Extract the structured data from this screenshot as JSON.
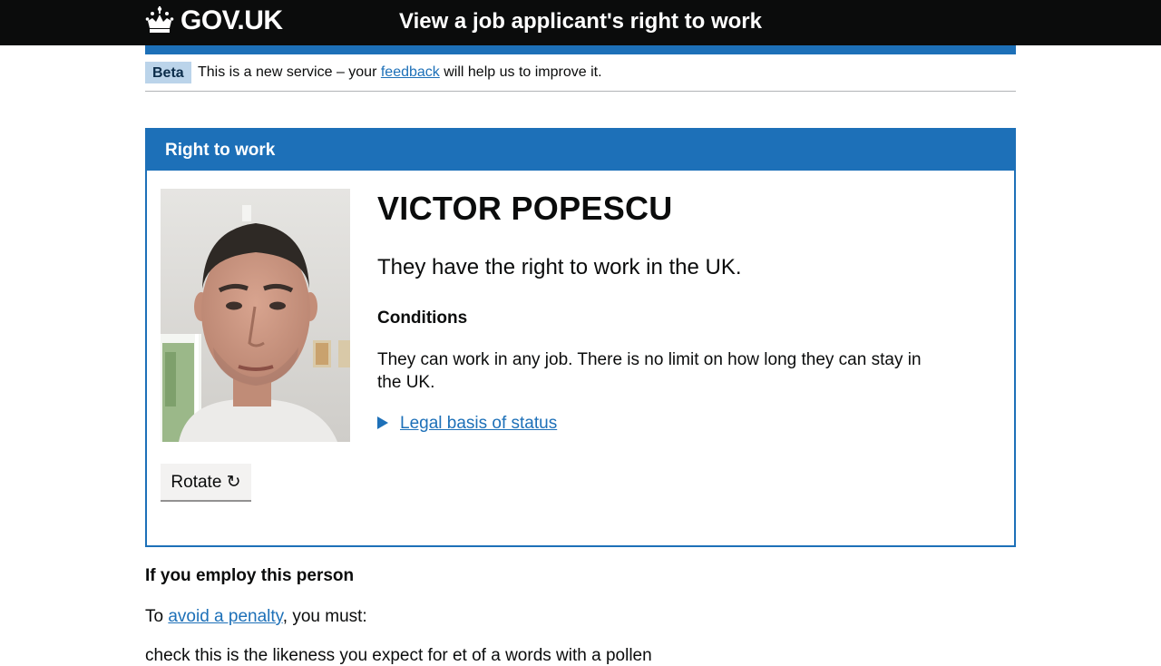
{
  "header": {
    "logo_text": "GOV.UK",
    "service_name": "View a job applicant's right to work"
  },
  "phase_banner": {
    "tag": "Beta",
    "text_before": "This is a new service – your ",
    "link_text": "feedback",
    "text_after": " will help us to improve it."
  },
  "panel": {
    "title": "Right to work",
    "person_name": "VICTOR POPESCU",
    "status": "They have the right to work in the UK.",
    "conditions_heading": "Conditions",
    "conditions_text": "They can work in any job. There is no limit on how long they can stay in the UK.",
    "details_link": "Legal basis of status",
    "rotate_label": "Rotate ↻"
  },
  "employ": {
    "heading": "If you employ this person",
    "penalty_before": "To ",
    "penalty_link": "avoid a penalty",
    "penalty_after": ", you must:",
    "next_line": "check this is the likeness you expect for et of a words with a pollen"
  },
  "colors": {
    "header_bg": "#0b0c0c",
    "brand_blue": "#1d70b8",
    "link": "#1d70b8",
    "beta_tag_bg": "#bbd4ea",
    "button_bg": "#f3f2f1"
  }
}
